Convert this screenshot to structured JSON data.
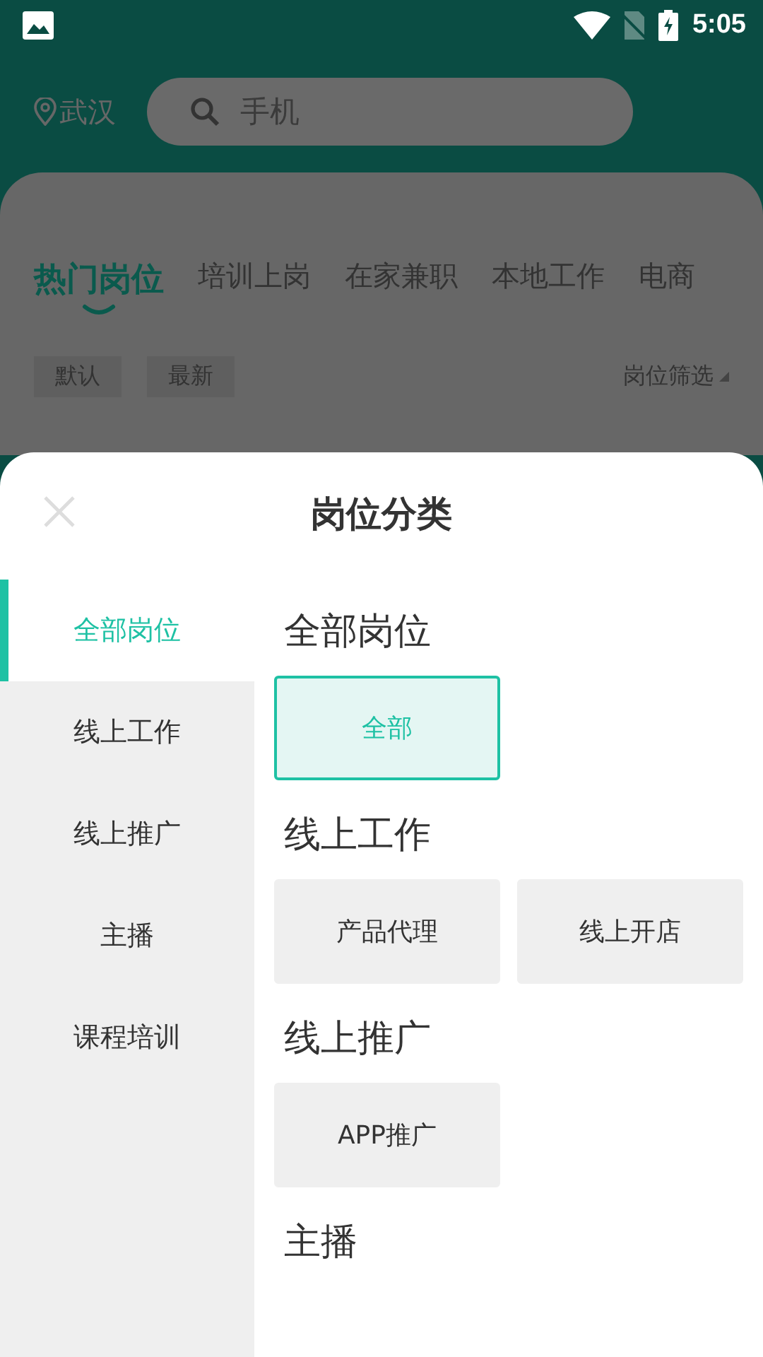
{
  "status_bar": {
    "time": "5:05"
  },
  "header": {
    "location": "武汉",
    "search": {
      "placeholder": "手机"
    }
  },
  "tabs": [
    {
      "label": "热门岗位",
      "selected": true
    },
    {
      "label": "培训上岗",
      "selected": false
    },
    {
      "label": "在家兼职",
      "selected": false
    },
    {
      "label": "本地工作",
      "selected": false
    },
    {
      "label": "电商",
      "selected": false
    }
  ],
  "sort_chips": [
    {
      "label": "默认"
    },
    {
      "label": "最新"
    }
  ],
  "filter": {
    "label": "岗位筛选"
  },
  "sheet": {
    "title": "岗位分类",
    "categories": [
      {
        "label": "全部岗位",
        "selected": true
      },
      {
        "label": "线上工作",
        "selected": false
      },
      {
        "label": "线上推广",
        "selected": false
      },
      {
        "label": "主播",
        "selected": false
      },
      {
        "label": "课程培训",
        "selected": false
      }
    ],
    "sections": [
      {
        "title": "全部岗位",
        "options": [
          {
            "label": "全部",
            "selected": true
          }
        ]
      },
      {
        "title": "线上工作",
        "options": [
          {
            "label": "产品代理",
            "selected": false
          },
          {
            "label": "线上开店",
            "selected": false
          }
        ]
      },
      {
        "title": "线上推广",
        "options": [
          {
            "label": "APP推广",
            "selected": false
          }
        ]
      },
      {
        "title": "主播"
      }
    ]
  }
}
